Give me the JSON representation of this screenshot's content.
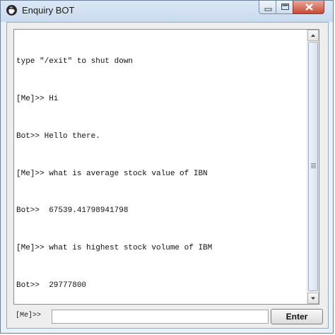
{
  "window": {
    "title": "Enquiry BOT",
    "icon": "java-cup-icon"
  },
  "title_buttons": [
    "minimize-icon",
    "maximize-icon",
    "close-icon"
  ],
  "chat": {
    "lines": [
      "type \"/exit\" to shut down",
      "[Me]>> Hi",
      "Bot>> Hello there.",
      "[Me]>> what is average stock value of IBN",
      "Bot>>  67539.41798941798",
      "[Me]>> what is highest stock volume of IBM",
      "Bot>>  29777800"
    ]
  },
  "input": {
    "prompt_label": "[Me]>>",
    "value": "",
    "enter_label": "Enter"
  }
}
